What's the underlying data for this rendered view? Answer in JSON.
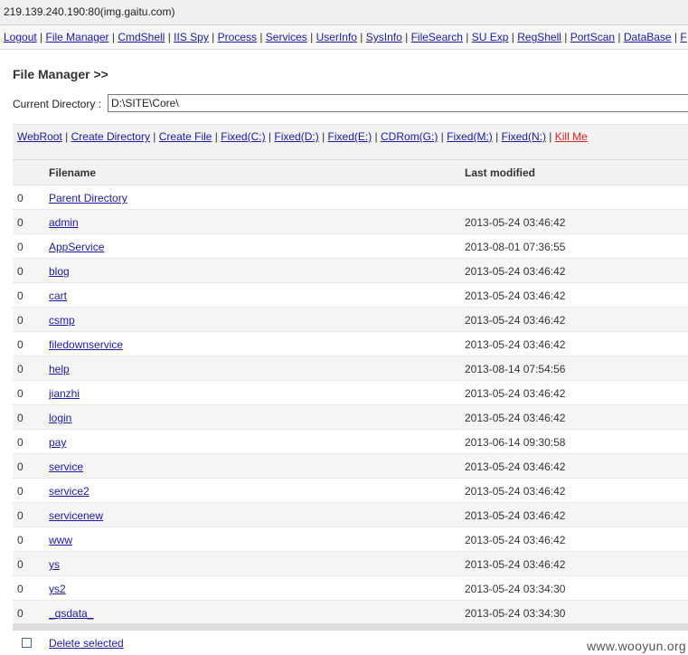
{
  "address": "219.139.240.190:80(img.gaitu.com)",
  "nav": [
    "Logout",
    "File Manager",
    "CmdShell",
    "IIS Spy",
    "Process",
    "Services",
    "UserInfo",
    "SysInfo",
    "FileSearch",
    "SU Exp",
    "RegShell",
    "PortScan",
    "DataBase",
    "F"
  ],
  "page_title": "File Manager >>",
  "current_directory": {
    "label": "Current Directory :",
    "value": "D:\\SITE\\Core\\"
  },
  "actions": [
    "WebRoot",
    "Create Directory",
    "Create File",
    "Fixed(C:)",
    "Fixed(D:)",
    "Fixed(E:)",
    "CDRom(G:)",
    "Fixed(M:)",
    "Fixed(N:)",
    "Kill Me"
  ],
  "table": {
    "headers": {
      "filename": "Filename",
      "modified": "Last modified"
    },
    "rows": [
      {
        "idx": "0",
        "name": "Parent Directory",
        "modified": ""
      },
      {
        "idx": "0",
        "name": "admin",
        "modified": "2013-05-24 03:46:42"
      },
      {
        "idx": "0",
        "name": "AppService",
        "modified": "2013-08-01 07:36:55"
      },
      {
        "idx": "0",
        "name": "blog",
        "modified": "2013-05-24 03:46:42"
      },
      {
        "idx": "0",
        "name": "cart",
        "modified": "2013-05-24 03:46:42"
      },
      {
        "idx": "0",
        "name": "csmp",
        "modified": "2013-05-24 03:46:42"
      },
      {
        "idx": "0",
        "name": "filedownservice",
        "modified": "2013-05-24 03:46:42"
      },
      {
        "idx": "0",
        "name": "help",
        "modified": "2013-08-14 07:54:56"
      },
      {
        "idx": "0",
        "name": "jianzhi",
        "modified": "2013-05-24 03:46:42"
      },
      {
        "idx": "0",
        "name": "login",
        "modified": "2013-05-24 03:46:42"
      },
      {
        "idx": "0",
        "name": "pay",
        "modified": "2013-06-14 09:30:58"
      },
      {
        "idx": "0",
        "name": "service",
        "modified": "2013-05-24 03:46:42"
      },
      {
        "idx": "0",
        "name": "service2",
        "modified": "2013-05-24 03:46:42"
      },
      {
        "idx": "0",
        "name": "servicenew",
        "modified": "2013-05-24 03:46:42"
      },
      {
        "idx": "0",
        "name": "www",
        "modified": "2013-05-24 03:46:42"
      },
      {
        "idx": "0",
        "name": "ys",
        "modified": "2013-05-24 03:46:42"
      },
      {
        "idx": "0",
        "name": "ys2",
        "modified": "2013-05-24 03:34:30"
      },
      {
        "idx": "0",
        "name": "_qsdata_",
        "modified": "2013-05-24 03:34:30"
      }
    ]
  },
  "footer": {
    "delete_label": "Delete selected"
  },
  "watermark": "www.wooyun.org",
  "colors": {
    "link": "#1a1aa6",
    "kill_me": "#e0201c",
    "row_alt": "#f5f5f5"
  }
}
